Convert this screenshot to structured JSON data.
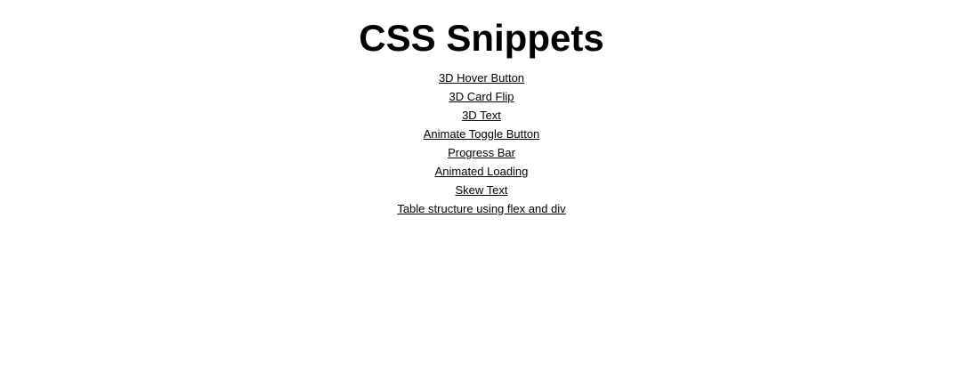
{
  "page": {
    "title": "CSS Snippets"
  },
  "snippets": [
    {
      "label": "3D Hover Button"
    },
    {
      "label": "3D Card Flip"
    },
    {
      "label": "3D Text"
    },
    {
      "label": "Animate Toggle Button"
    },
    {
      "label": "Progress Bar"
    },
    {
      "label": "Animated Loading"
    },
    {
      "label": "Skew Text"
    },
    {
      "label": "Table structure using flex and div"
    }
  ],
  "colors": {
    "background": "#ffffff",
    "text": "#000000",
    "link": "#000000"
  }
}
